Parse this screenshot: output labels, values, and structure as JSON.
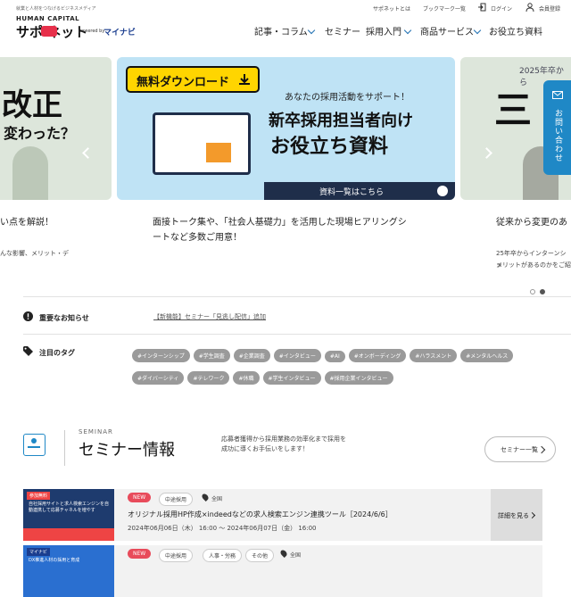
{
  "header": {
    "tagline": "就業と人材をつなげるビジネスメディア",
    "logo_hc": "HUMAN CAPITAL",
    "logo_main": "サポ    ネット",
    "powered_by": "powered by",
    "mynavi": "マイナビ",
    "util_about": "サポネットとは",
    "util_bookmark": "ブックマーク一覧",
    "util_login": "ログイン",
    "util_member": "会員登録",
    "nav": [
      "記事・コラム",
      "セミナー",
      "採用入門",
      "商品サービス",
      "お役立ち資料"
    ]
  },
  "carousel": {
    "left_big": "改正",
    "left_sub": "変わった？",
    "center_badge": "無料ダウンロード",
    "center_sub": "あなたの採用活動をサポート！",
    "center_title1": "新卒採用担当者向け",
    "center_title2": "お役立ち資料",
    "center_bar": "資料一覧はこちら",
    "right_top": "2025年卒から",
    "right_big": "三",
    "caption_left_1": "い点を解説！",
    "caption_left_2": "んな影響、メリット・デ",
    "caption_center_1": "面接トーク集や、「社会人基礎力」を活用した現場ヒアリングシ",
    "caption_center_2": "ートなど多数ご用意！",
    "caption_right_1": "従来から変更のあ",
    "caption_right_2": "25年卒からインターンシッ",
    "caption_right_3": "メリットがあるのかをご紹"
  },
  "contact": {
    "label": "お問い合わせ"
  },
  "notice": {
    "label": "重要なお知らせ",
    "link": "【新機能】セミナー「見逃し配信」追加"
  },
  "tags": {
    "label": "注目のタグ",
    "items": [
      "#インターンシップ",
      "#学生調査",
      "#企業調査",
      "#インタビュー",
      "#AI",
      "#オンボーディング",
      "#ハラスメント",
      "#メンタルヘルス",
      "#ダイバーシティ",
      "#テレワーク",
      "#休職",
      "#学生インタビュー",
      "#採用企業インタビュー"
    ]
  },
  "seminar": {
    "en": "SEMINAR",
    "title": "セミナー情報",
    "desc": "応募者獲得から採用業務の効率化まで採用を成功に導くお手伝いをします！",
    "all_button": "セミナー一覧",
    "rows": [
      {
        "badge": "NEW",
        "category": "中途採用",
        "location": "全国",
        "title": "オリジナル採用HP作成×indeedなどの求人検索エンジン連携ツール［2024/6/6］",
        "date": "2024年06月06日（木） 16:00 ～ 2024年06月07日（金） 16:00",
        "detail": "詳細を見る",
        "thumb_label": "参加無料",
        "thumb_title": "自社採用サイトと求人検索エンジンを自動連携して応募チャネルを増やす"
      },
      {
        "badge": "NEW",
        "category": "中途採用",
        "category2": "人事・労務",
        "category3": "その他",
        "location": "全国",
        "thumb_label": "マイナビ",
        "thumb_title": "DX推進人材の採用と育成"
      }
    ]
  }
}
